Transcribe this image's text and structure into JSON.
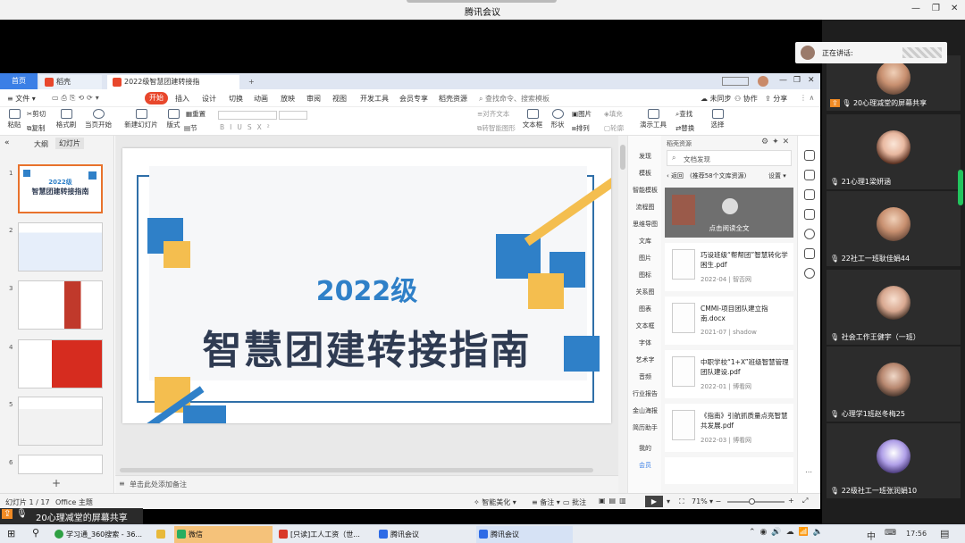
{
  "window": {
    "title": "腾讯会议"
  },
  "speaking": {
    "label": "正在讲话:"
  },
  "share_label": "20心理减堂的屏幕共享",
  "wps": {
    "tabs": {
      "home": "首页",
      "daoke": "稻壳",
      "file": "2022级智慧团建转接指南.pptx"
    },
    "menu": {
      "file": "文件",
      "start": "开始",
      "items": [
        "插入",
        "设计",
        "切换",
        "动画",
        "放映",
        "审阅",
        "视图",
        "开发工具",
        "会员专享",
        "稻壳资源"
      ],
      "search": "查找命令、搜索模板",
      "cloud": "未同步",
      "collab": "协作",
      "share": "分享"
    },
    "ribbon": [
      "粘贴",
      "剪切",
      "复制",
      "格式刷",
      "当页开始",
      "新建幻灯片",
      "版式",
      "节",
      "重置",
      "文本框",
      "形状",
      "排列",
      "演示工具",
      "查找",
      "替换",
      "选择",
      "图片",
      "填充",
      "轮廓",
      "对齐文本",
      "转智能图形"
    ],
    "left_tabs": {
      "outline": "大纲",
      "slides": "幻灯片"
    },
    "slide": {
      "year": "2022级",
      "title": "智慧团建转接指南"
    },
    "thumb1": {
      "year": "2022级",
      "title": "智慧团建转接指南"
    },
    "notes": "单击此处添加备注",
    "status": {
      "page": "幻灯片 1 / 17",
      "theme": "Office 主题",
      "beautify": "智能美化",
      "remark": "备注",
      "comment": "批注",
      "zoom": "71%"
    },
    "resource": {
      "header": "稻壳资源",
      "search": "文档发现",
      "back": "返回",
      "hint": "(推荐58个文库资源)",
      "settings": "设置",
      "overlay": "点击阅读全文",
      "cards": [
        {
          "title": "巧设班级“帮帮团”智慧转化学困生.pdf",
          "date": "2022-04",
          "src": "智否网"
        },
        {
          "title": "CMMI-项目团队建立指南.docx",
          "date": "2021-07",
          "src": "shadow"
        },
        {
          "title": "中职学校“1+X”班级智慧管理团队建设.pdf",
          "date": "2022-01",
          "src": "博看网"
        },
        {
          "title": "《指南》引航抓质量点亮智慧共发展.pdf",
          "date": "2022-03",
          "src": "博看网"
        }
      ],
      "cats": [
        "发现",
        "模板",
        "智能模板",
        "流程图",
        "思维导图",
        "文库",
        "图片",
        "图标",
        "关系图",
        "图表",
        "文本框",
        "字体",
        "艺术字",
        "音频",
        "行业报告",
        "金山海报",
        "简历助手",
        "我的",
        "会员"
      ]
    }
  },
  "participants": [
    {
      "name": "20心理减堂的屏幕共享"
    },
    {
      "name": "21心理1梁妍涵"
    },
    {
      "name": "22社工一班耿佳娟44"
    },
    {
      "name": "社会工作王健宇（一班）"
    },
    {
      "name": "心理学1班赵冬梅25"
    },
    {
      "name": "22级社工一班张润娟10"
    }
  ],
  "taskbar": {
    "items": [
      "学习通_360搜索 - 36...",
      "",
      "微信",
      "[只读]工人工资（世...",
      "腾讯会议",
      "腾讯会议"
    ],
    "ime": "中",
    "time": "17:56"
  },
  "colors": {
    "accent": "#3b7fe6",
    "slide_blue": "#2f80c8",
    "slide_yellow": "#f4be4f",
    "title_text": "#2f3b52",
    "start_red": "#e8472c"
  }
}
